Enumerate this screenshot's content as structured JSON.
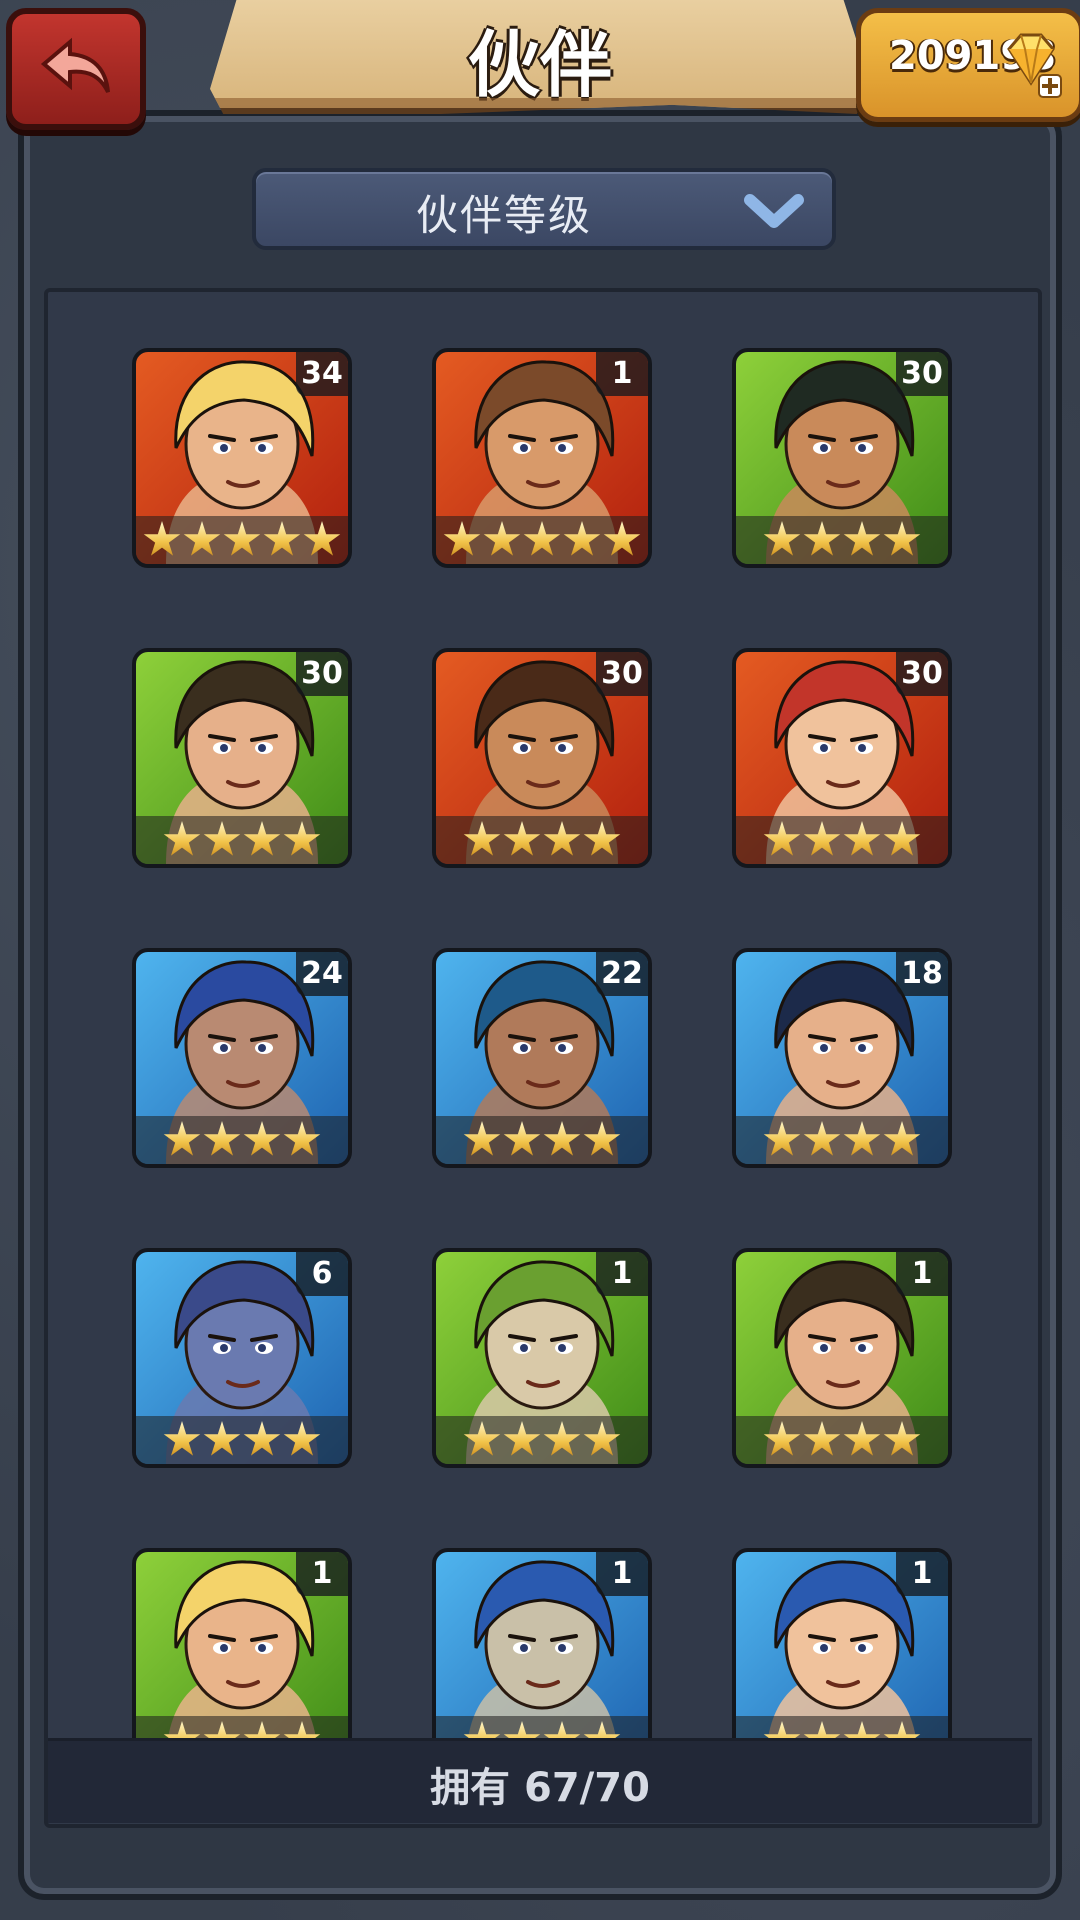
{
  "header": {
    "title": "伙伴",
    "currency_value": "209198",
    "back_icon": "back-arrow-icon",
    "gem_icon": "gem-plus-icon",
    "colors": {
      "banner": "#e2c28d",
      "back": "#b02a25",
      "currency": "#e9a83a"
    }
  },
  "filter": {
    "label": "伙伴等级",
    "icon": "chevron-down-icon"
  },
  "companions": [
    {
      "level": "34",
      "stars": 5,
      "bg": "red",
      "hair": "#f4d36a",
      "skin": "#e9b48a"
    },
    {
      "level": "1",
      "stars": 5,
      "bg": "red",
      "hair": "#7b4a2a",
      "skin": "#d89a6a"
    },
    {
      "level": "30",
      "stars": 4,
      "bg": "green",
      "hair": "#1f2a22",
      "skin": "#c98a5a"
    },
    {
      "level": "30",
      "stars": 4,
      "bg": "green",
      "hair": "#3a2e1e",
      "skin": "#e6b08a"
    },
    {
      "level": "30",
      "stars": 4,
      "bg": "red",
      "hair": "#4a2a18",
      "skin": "#c98a5a"
    },
    {
      "level": "30",
      "stars": 4,
      "bg": "red",
      "hair": "#c2352a",
      "skin": "#f0c29c"
    },
    {
      "level": "24",
      "stars": 4,
      "bg": "blue",
      "hair": "#2a4aa0",
      "skin": "#b98a72"
    },
    {
      "level": "22",
      "stars": 4,
      "bg": "blue",
      "hair": "#1e5a8a",
      "skin": "#b07a5a"
    },
    {
      "level": "18",
      "stars": 4,
      "bg": "blue",
      "hair": "#1c2a4a",
      "skin": "#e6b08a"
    },
    {
      "level": "6",
      "stars": 4,
      "bg": "blue",
      "hair": "#3a4a8a",
      "skin": "#6a7ab0"
    },
    {
      "level": "1",
      "stars": 4,
      "bg": "green",
      "hair": "#6aa030",
      "skin": "#d9c9a8"
    },
    {
      "level": "1",
      "stars": 4,
      "bg": "green",
      "hair": "#3a2e1e",
      "skin": "#e6b08a"
    },
    {
      "level": "1",
      "stars": 4,
      "bg": "green",
      "hair": "#f4d36a",
      "skin": "#e9b48a"
    },
    {
      "level": "1",
      "stars": 4,
      "bg": "blue",
      "hair": "#2a5ab0",
      "skin": "#c9c0a8"
    },
    {
      "level": "1",
      "stars": 4,
      "bg": "blue",
      "hair": "#2a5ab0",
      "skin": "#f0c29c"
    }
  ],
  "footer": {
    "owned_label": "拥有 67/70"
  }
}
